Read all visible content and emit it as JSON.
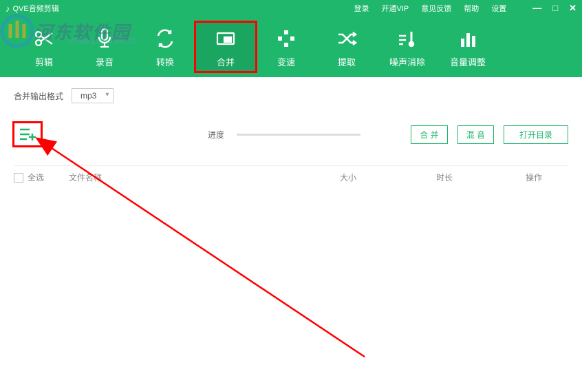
{
  "app": {
    "title": "QVE音频剪辑"
  },
  "topLinks": {
    "login": "登录",
    "vip": "开通VIP",
    "feedback": "意见反馈",
    "help": "帮助",
    "settings": "设置"
  },
  "watermark": {
    "text": "河东软件园",
    "url": "www.pc0359.cn"
  },
  "nav": {
    "items": [
      {
        "label": "剪辑"
      },
      {
        "label": "录音"
      },
      {
        "label": "转换"
      },
      {
        "label": "合并"
      },
      {
        "label": "变速"
      },
      {
        "label": "提取"
      },
      {
        "label": "噪声消除"
      },
      {
        "label": "音量调整"
      }
    ]
  },
  "formatRow": {
    "label": "合并输出格式",
    "value": "mp3"
  },
  "progress": {
    "label": "进度"
  },
  "buttons": {
    "merge": "合 并",
    "mix": "混 音",
    "openDir": "打开目录"
  },
  "table": {
    "selectAll": "全选",
    "fileName": "文件名称",
    "size": "大小",
    "duration": "时长",
    "operation": "操作"
  }
}
